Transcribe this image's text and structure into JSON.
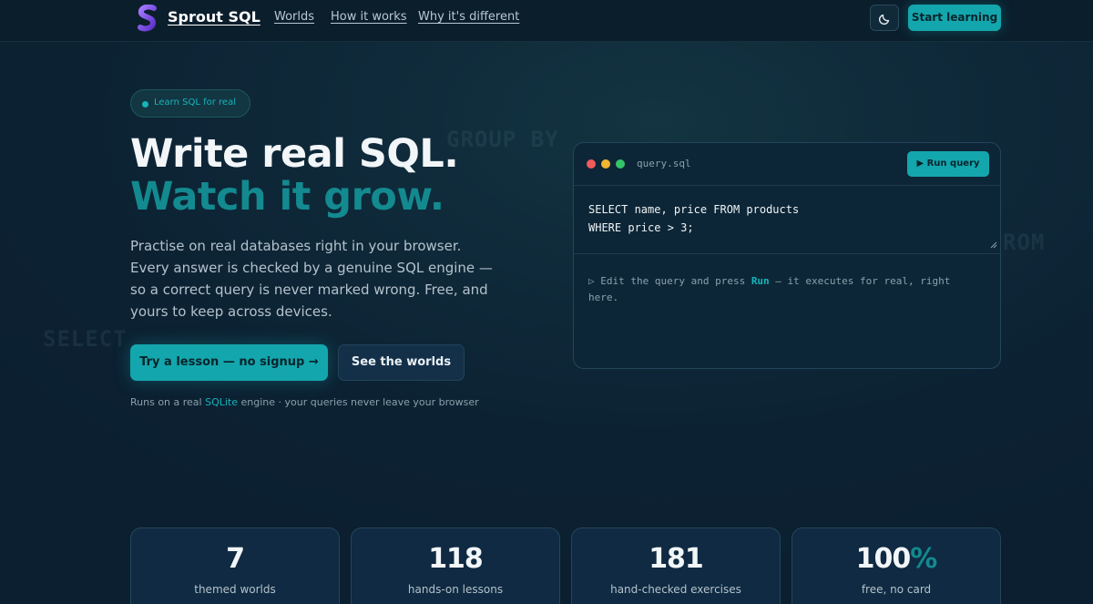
{
  "nav": {
    "brand": "Sprout SQL",
    "links": [
      "Worlds",
      "How it works",
      "Why it's different"
    ],
    "cta": "Start learning",
    "theme_icon": "moon-icon"
  },
  "ghost_keywords": [
    "GROUP BY",
    "ROM",
    "SELECT"
  ],
  "hero": {
    "badge": "Learn SQL for real",
    "title_line1": "Write real SQL.",
    "title_line2": "Watch it grow.",
    "lede": "Practise on real databases right in your browser. Every answer is checked by a genuine SQL engine — so a correct query is never marked wrong. Free, and yours to keep across devices.",
    "primary_cta": "Try a lesson — no signup →",
    "secondary_cta": "See the worlds",
    "note_prefix": "Runs on a real ",
    "note_highlight": "SQLite",
    "note_suffix": " engine · your queries never leave your browser"
  },
  "editor": {
    "filename": "query.sql",
    "run_label": "▶ Run query",
    "code_lines": [
      "SELECT name, price FROM products",
      "WHERE price > 3;"
    ],
    "output_prefix": "▷ Edit the query and press ",
    "output_run": "Run",
    "output_suffix": " — it executes for real, right here.",
    "dot_colors": [
      "#ef5b5b",
      "#f2b630",
      "#35c46a"
    ]
  },
  "stats": [
    {
      "number": "7",
      "label": "themed worlds"
    },
    {
      "number": "118",
      "label": "hands-on lessons"
    },
    {
      "number": "181",
      "label": "hand-checked exercises"
    },
    {
      "number": "100",
      "suffix": "%",
      "label": "free, no card"
    }
  ],
  "colors": {
    "accent": "#14a6ad",
    "accent_dark": "#138a8f",
    "logo": "#7b4fe0"
  }
}
